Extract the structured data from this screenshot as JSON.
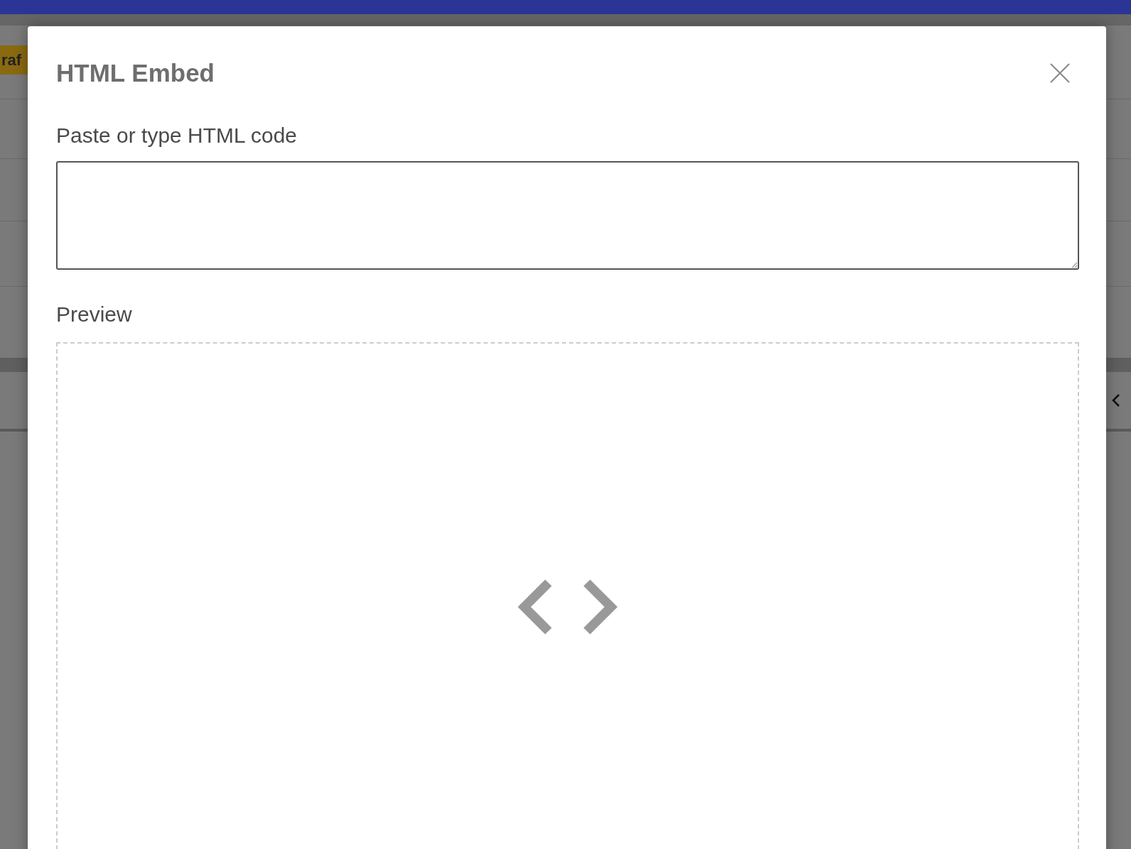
{
  "background": {
    "status_badge": {
      "label": "raf"
    }
  },
  "dialog": {
    "title": "HTML Embed",
    "code_field": {
      "label": "Paste or type HTML code"
    },
    "preview": {
      "label": "Preview"
    }
  }
}
